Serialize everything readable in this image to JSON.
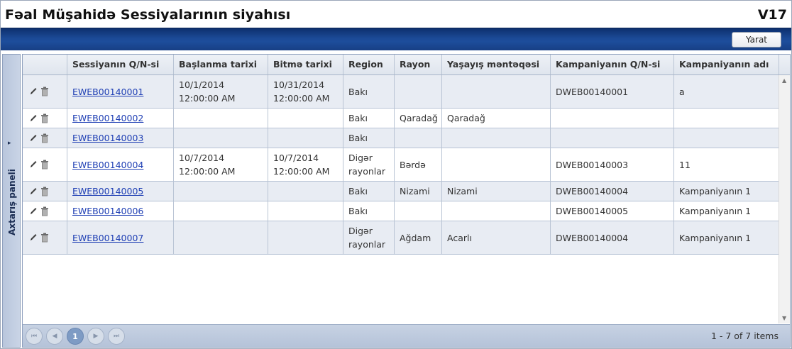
{
  "page": {
    "title": "Fəal Müşahidə Sessiyalarının siyahısı",
    "version": "V17"
  },
  "toolbar": {
    "create_label": "Yarat"
  },
  "side_panel": {
    "label": "Axtarış paneli",
    "arrow": "▸"
  },
  "table": {
    "headers": {
      "session_id": "Sessiyanın Q/N-si",
      "start_date": "Başlanma tarixi",
      "end_date": "Bitmə tarixi",
      "region": "Region",
      "rayon": "Rayon",
      "settlement": "Yaşayış məntəqəsi",
      "campaign_id": "Kampaniyanın Q/N-si",
      "campaign_name": "Kampaniyanın adı"
    },
    "rows": [
      {
        "session_id": "EWEB00140001",
        "start_date": "10/1/2014\n12:00:00 AM",
        "end_date": "10/31/2014\n12:00:00 AM",
        "region": "Bakı",
        "rayon": "",
        "settlement": "",
        "campaign_id": "DWEB00140001",
        "campaign_name": "a"
      },
      {
        "session_id": "EWEB00140002",
        "start_date": "",
        "end_date": "",
        "region": "Bakı",
        "rayon": "Qaradağ",
        "settlement": "Qaradağ",
        "campaign_id": "",
        "campaign_name": ""
      },
      {
        "session_id": "EWEB00140003",
        "start_date": "",
        "end_date": "",
        "region": "Bakı",
        "rayon": "",
        "settlement": "",
        "campaign_id": "",
        "campaign_name": ""
      },
      {
        "session_id": "EWEB00140004",
        "start_date": "10/7/2014\n12:00:00 AM",
        "end_date": "10/7/2014\n12:00:00 AM",
        "region": "Digər\nrayonlar",
        "rayon": "Bərdə",
        "settlement": "",
        "campaign_id": "DWEB00140003",
        "campaign_name": "11"
      },
      {
        "session_id": "EWEB00140005",
        "start_date": "",
        "end_date": "",
        "region": "Bakı",
        "rayon": "Nizami",
        "settlement": "Nizami",
        "campaign_id": "DWEB00140004",
        "campaign_name": "Kampaniyanın 1"
      },
      {
        "session_id": "EWEB00140006",
        "start_date": "",
        "end_date": "",
        "region": "Bakı",
        "rayon": "",
        "settlement": "",
        "campaign_id": "DWEB00140005",
        "campaign_name": "Kampaniyanın 1"
      },
      {
        "session_id": "EWEB00140007",
        "start_date": "",
        "end_date": "",
        "region": "Digər\nrayonlar",
        "rayon": "Ağdam",
        "settlement": "Acarlı",
        "campaign_id": "DWEB00140004",
        "campaign_name": "Kampaniyanın 1"
      }
    ]
  },
  "pager": {
    "current_page": "1",
    "info": "1 - 7 of 7 items",
    "first": "⏮",
    "prev": "◀",
    "next": "▶",
    "last": "⏭"
  },
  "icons": {
    "edit": "pencil-icon",
    "delete": "trash-icon"
  },
  "colors": {
    "header_band": "#1b4a96",
    "link": "#1f3fb4",
    "alt_row": "#e8ecf3",
    "pager": "#b5c3d9"
  }
}
